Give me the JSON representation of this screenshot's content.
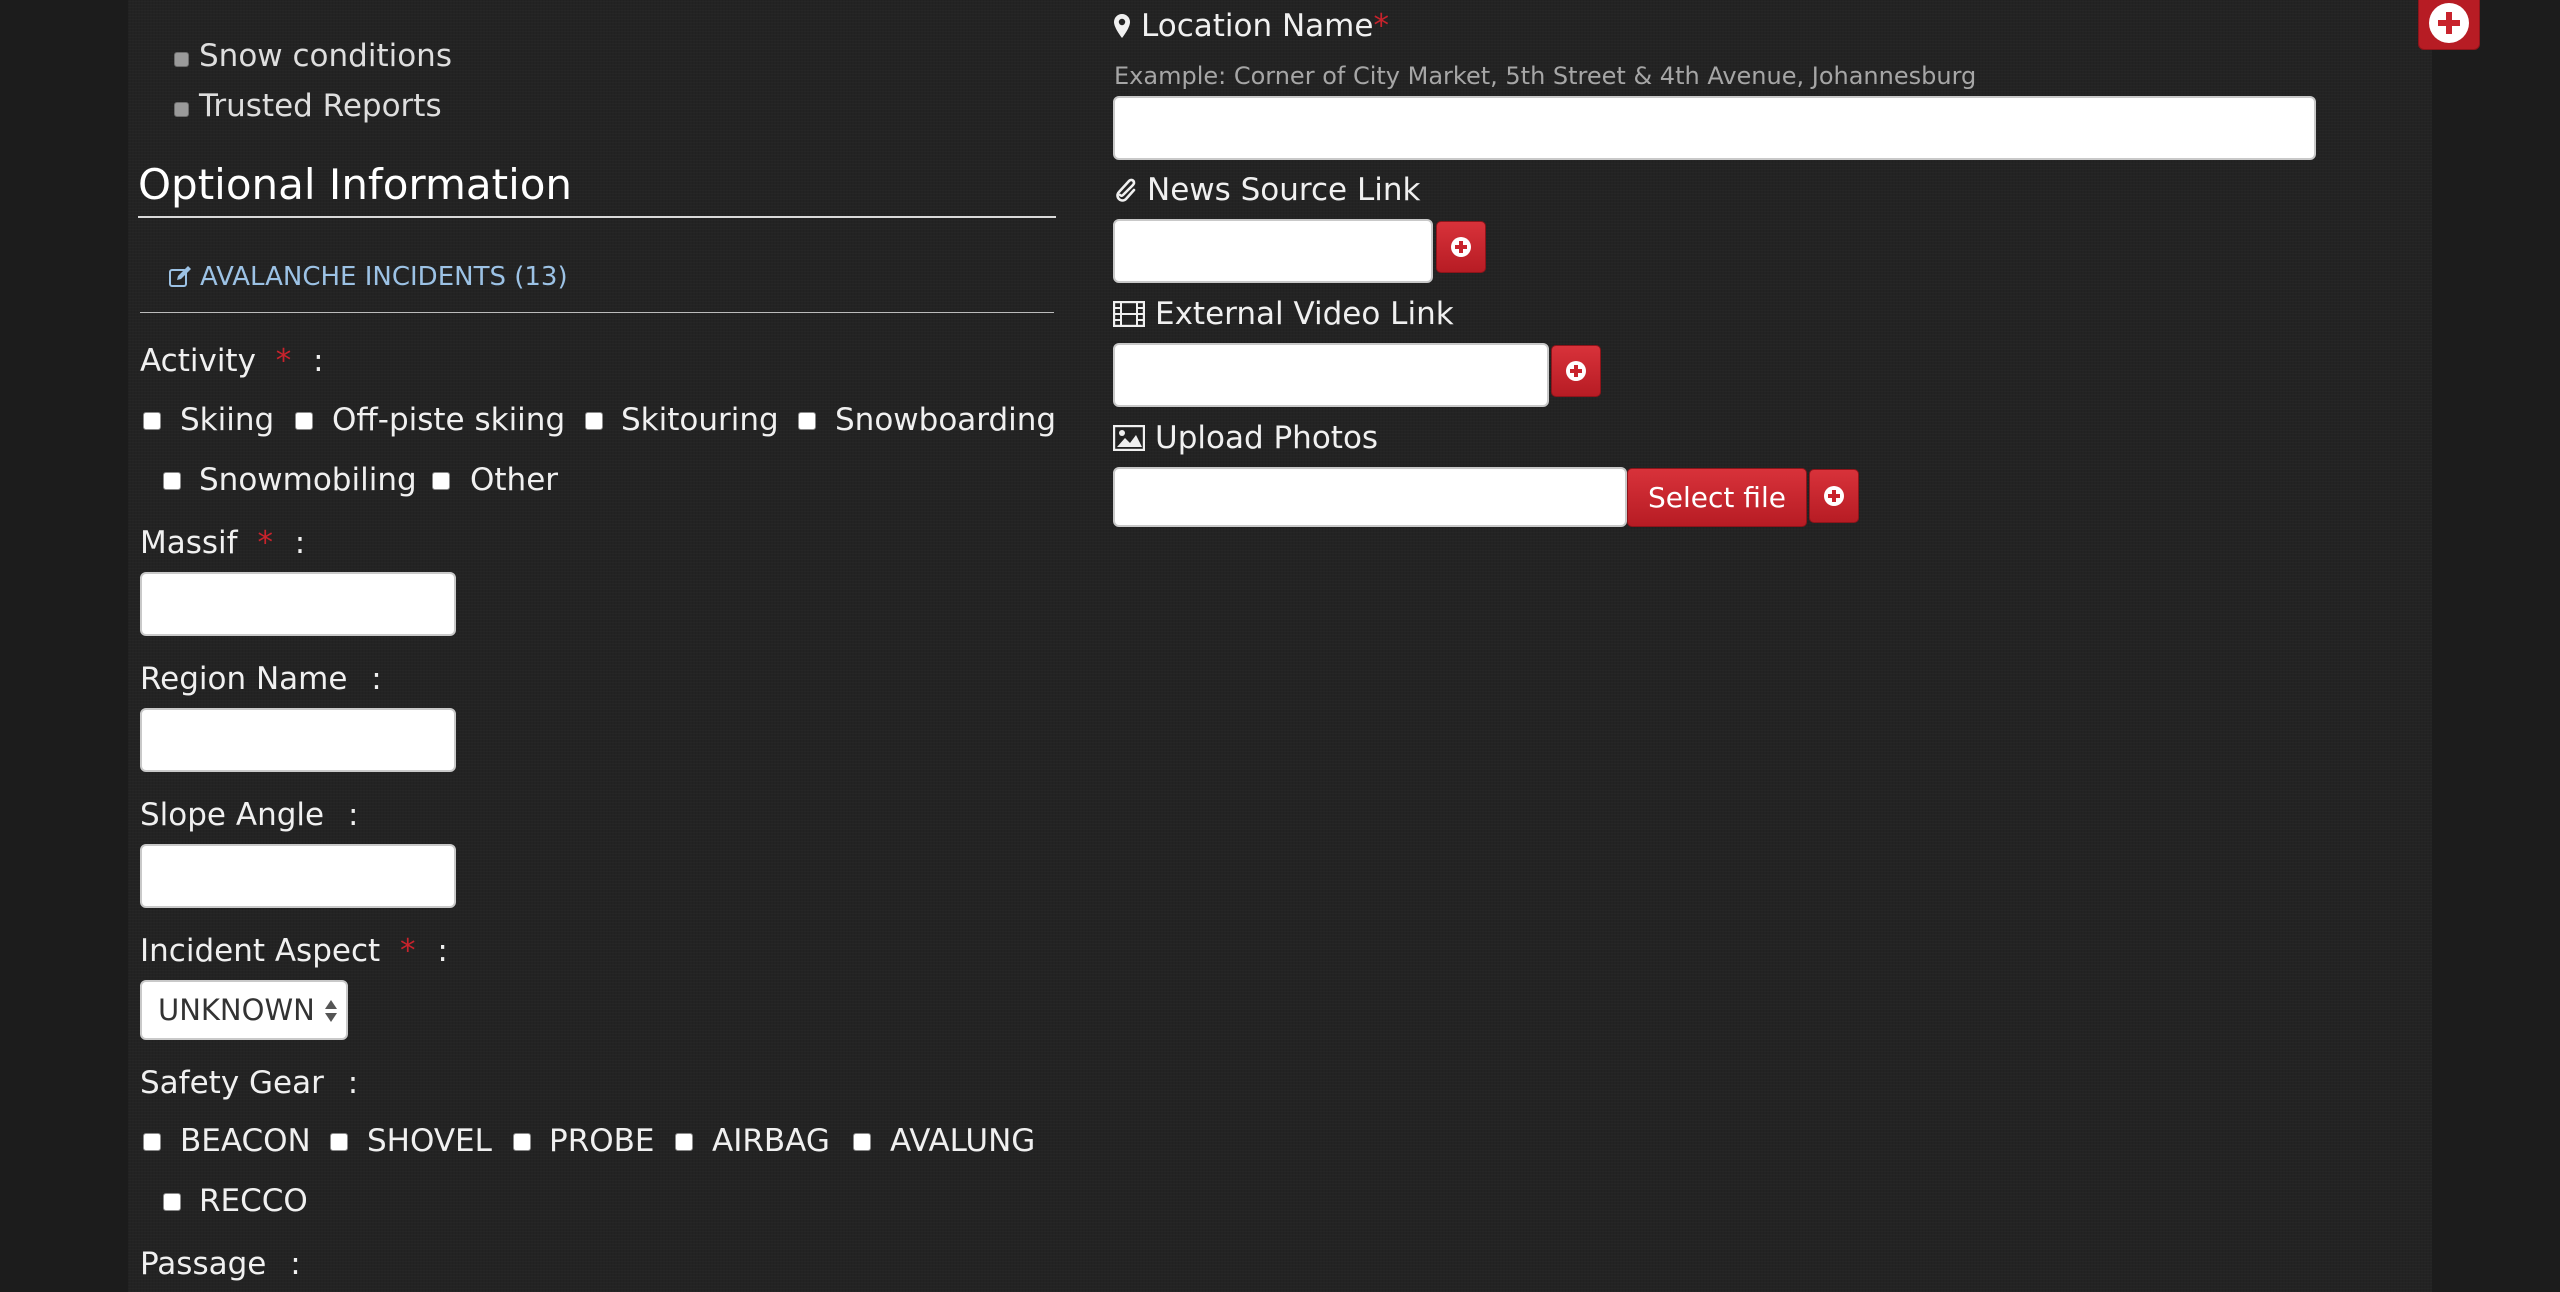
{
  "filters": {
    "snow_conditions": "Snow conditions",
    "trusted_reports": "Trusted Reports"
  },
  "optional": {
    "heading": "Optional Information",
    "incidents_link": "AVALANCHE INCIDENTS (13)"
  },
  "activity": {
    "label": "Activity",
    "required_mark": "*",
    "colon": ":",
    "options": [
      "Skiing",
      "Off-piste skiing",
      "Skitouring",
      "Snowboarding",
      "Snowmobiling",
      "Other"
    ]
  },
  "massif": {
    "label": "Massif",
    "required_mark": "*",
    "colon": ":",
    "value": ""
  },
  "region": {
    "label": "Region Name",
    "colon": ":",
    "value": ""
  },
  "slope": {
    "label": "Slope Angle",
    "colon": ":",
    "value": ""
  },
  "aspect": {
    "label": "Incident Aspect",
    "required_mark": "*",
    "colon": ":",
    "selected": "UNKNOWN"
  },
  "safety": {
    "label": "Safety Gear",
    "colon": ":",
    "options": [
      "BEACON",
      "SHOVEL",
      "PROBE",
      "AIRBAG",
      "AVALUNG",
      "RECCO"
    ]
  },
  "passage": {
    "label": "Passage",
    "colon": ":"
  },
  "location": {
    "label": "Location Name",
    "required_mark": "*",
    "example": "Example: Corner of City Market, 5th Street & 4th Avenue, Johannesburg",
    "value": ""
  },
  "news": {
    "label": "News Source Link",
    "value": ""
  },
  "video": {
    "label": "External Video Link",
    "value": ""
  },
  "photos": {
    "label": "Upload Photos",
    "button": "Select file",
    "value": ""
  },
  "colors": {
    "accent_red": "#c8232c",
    "link_blue": "#9cc2e5",
    "background": "#232323"
  },
  "icons": {
    "location": "map-marker-icon",
    "news": "paperclip-icon",
    "video": "film-icon",
    "photos": "picture-icon",
    "incidents": "edit-icon",
    "add": "plus-circle-icon"
  }
}
